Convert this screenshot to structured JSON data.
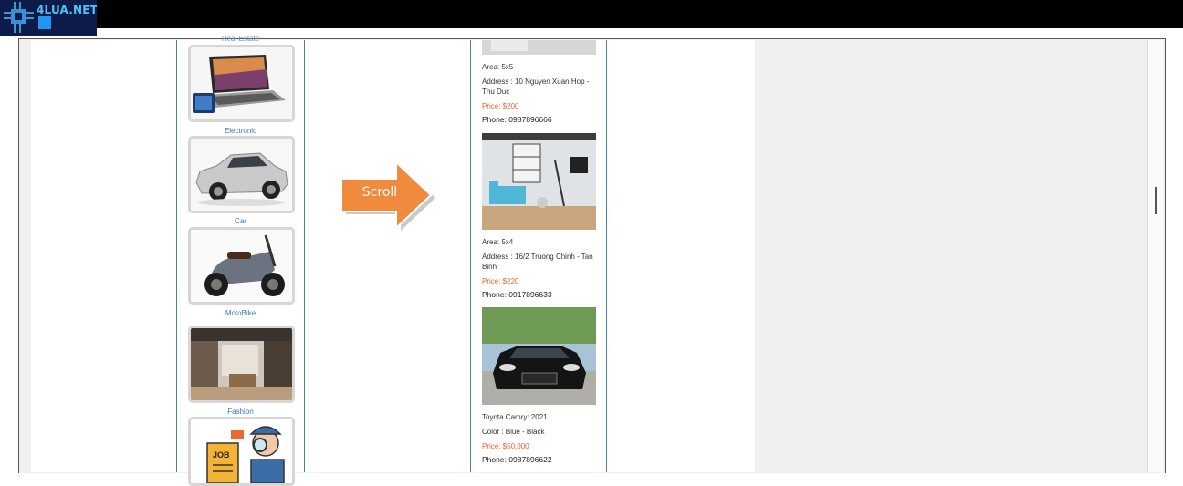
{
  "logo": {
    "text": "4LUA.NET",
    "icon": "circuit-chip-icon"
  },
  "categories": {
    "cut_label": "Real Estate",
    "items": [
      {
        "label": "Electronic",
        "icon": "laptop-image"
      },
      {
        "label": "Car",
        "icon": "car-image"
      },
      {
        "label": "MotoBike",
        "icon": "scooter-image"
      },
      {
        "label": "Fashion",
        "icon": "shop-interior-image"
      },
      {
        "label": "",
        "icon": "job-search-image",
        "job_text": "JOB"
      }
    ]
  },
  "annotation": {
    "arrow_label": "Scroll",
    "color": "#f08a3c"
  },
  "listings": [
    {
      "area": "Area: 5x5",
      "address": "Address : 10 Nguyen Xuan Hop - Thu Duc",
      "price": "Price: $200",
      "phone": "Phone: 0987896666"
    },
    {
      "area": "Area: 5x4",
      "address": "Address : 16/2 Truong Chinh - Tan Binh",
      "price": "Price: $220",
      "phone": "Phone: 0917896633"
    },
    {
      "area": "Toyota Camry: 2021",
      "address": "Color : Blue - Black",
      "price": "Price: $50,000",
      "phone": "Phone: 0987896622"
    }
  ],
  "colors": {
    "accent": "#3a77b8",
    "price": "#e8622a",
    "border": "#4a7fb0"
  }
}
